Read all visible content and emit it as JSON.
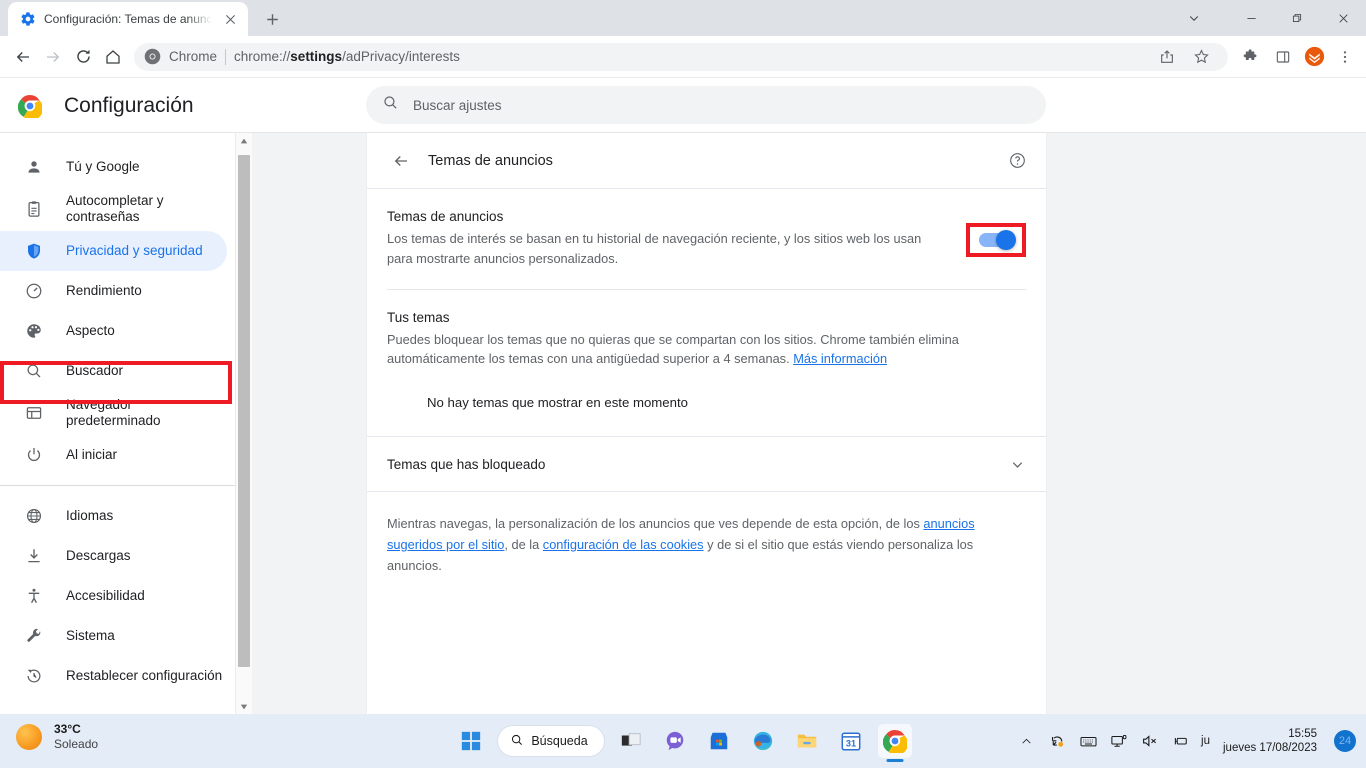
{
  "window": {
    "tab": {
      "title": "Configuración: Temas de anuncio",
      "favicon": "settings-gear-icon",
      "close": "×"
    },
    "new_tab_label": "+",
    "controls": {
      "tabsearch": "chevron-down-icon",
      "minimize": "—",
      "maximize": "restore-icon",
      "close": "✕"
    }
  },
  "toolbar": {
    "back": "back-arrow-icon",
    "forward": "forward-arrow-icon",
    "reload": "reload-icon",
    "home": "home-icon",
    "omnibox": {
      "chip": "Chrome",
      "url_prefix": "chrome://",
      "url_bold": "settings",
      "url_suffix": "/adPrivacy/interests",
      "full_url": "chrome://settings/adPrivacy/interests"
    },
    "share_icon": "share-icon",
    "bookmark_icon": "star-icon",
    "extensions_icon": "puzzle-icon",
    "side_panel_icon": "side-panel-icon",
    "profile_icon": "profile-avatar",
    "menu_icon": "three-dot-menu-icon"
  },
  "settings_header": {
    "logo": "chrome-logo",
    "title": "Configuración",
    "search": {
      "icon": "search-icon",
      "placeholder": "Buscar ajustes",
      "value": ""
    }
  },
  "sidebar": {
    "items": [
      {
        "label": "Tú y Google",
        "icon": "person-icon",
        "active": false
      },
      {
        "label": "Autocompletar y contraseñas",
        "icon": "clipboard-icon",
        "active": false
      },
      {
        "label": "Privacidad y seguridad",
        "icon": "shield-icon",
        "active": true
      },
      {
        "label": "Rendimiento",
        "icon": "speedometer-icon",
        "active": false
      },
      {
        "label": "Aspecto",
        "icon": "palette-icon",
        "active": false
      },
      {
        "label": "Buscador",
        "icon": "search-icon",
        "active": false
      },
      {
        "label": "Navegador predeterminado",
        "icon": "browser-window-icon",
        "active": false
      },
      {
        "label": "Al iniciar",
        "icon": "power-icon",
        "active": false
      },
      {
        "label": "Idiomas",
        "icon": "globe-icon",
        "active": false
      },
      {
        "label": "Descargas",
        "icon": "download-icon",
        "active": false
      },
      {
        "label": "Accesibilidad",
        "icon": "accessibility-icon",
        "active": false
      },
      {
        "label": "Sistema",
        "icon": "wrench-icon",
        "active": false
      },
      {
        "label": "Restablecer configuración",
        "icon": "history-restore-icon",
        "active": false
      }
    ]
  },
  "main": {
    "header": {
      "back_icon": "back-arrow-icon",
      "title": "Temas de anuncios",
      "help_icon": "help-circle-icon"
    },
    "ad_topics": {
      "title": "Temas de anuncios",
      "description": "Los temas de interés se basan en tu historial de navegación reciente, y los sitios web los usan para mostrarte anuncios personalizados.",
      "toggle_on": true
    },
    "your_topics": {
      "title": "Tus temas",
      "description": "Puedes bloquear los temas que no quieras que se compartan con los sitios. Chrome también elimina automáticamente los temas con una antigüedad superior a 4 semanas.",
      "link": "Más información",
      "empty_message": "No hay temas que mostrar en este momento"
    },
    "blocked": {
      "title": "Temas que has bloqueado",
      "chevron": "chevron-down-icon"
    },
    "footnote": {
      "part1": "Mientras navegas, la personalización de los anuncios que ves depende de esta opción, de los ",
      "link1": "anuncios sugeridos por el sitio",
      "part2": ", de la ",
      "link2": "configuración de las cookies",
      "part3": " y de si el sitio que estás viendo personaliza los anuncios."
    }
  },
  "taskbar": {
    "weather": {
      "temperature": "33°C",
      "condition": "Soleado",
      "icon": "sun-icon"
    },
    "start_icon": "windows-start-icon",
    "search": {
      "icon": "search-icon",
      "label": "Búsqueda"
    },
    "apps": [
      {
        "name": "task-view-icon"
      },
      {
        "name": "chat-icon"
      },
      {
        "name": "microsoft-store-icon"
      },
      {
        "name": "edge-icon"
      },
      {
        "name": "file-explorer-icon"
      },
      {
        "name": "calendar-icon",
        "label": "31"
      },
      {
        "name": "chrome-icon",
        "active": true
      }
    ],
    "tray": {
      "overflow_icon": "chevron-up-icon",
      "sync_icon": "onedrive-sync-icon",
      "keyboard_icon": "keyboard-icon",
      "display_icon": "display-cast-icon",
      "volume_icon": "speaker-muted-icon",
      "battery_icon": "battery-plug-icon",
      "prefix": "ju",
      "time": "15:55",
      "date": "jueves 17/08/2023",
      "notification_count": "24"
    }
  },
  "annotations": {
    "highlight_color": "#ee1b24"
  }
}
